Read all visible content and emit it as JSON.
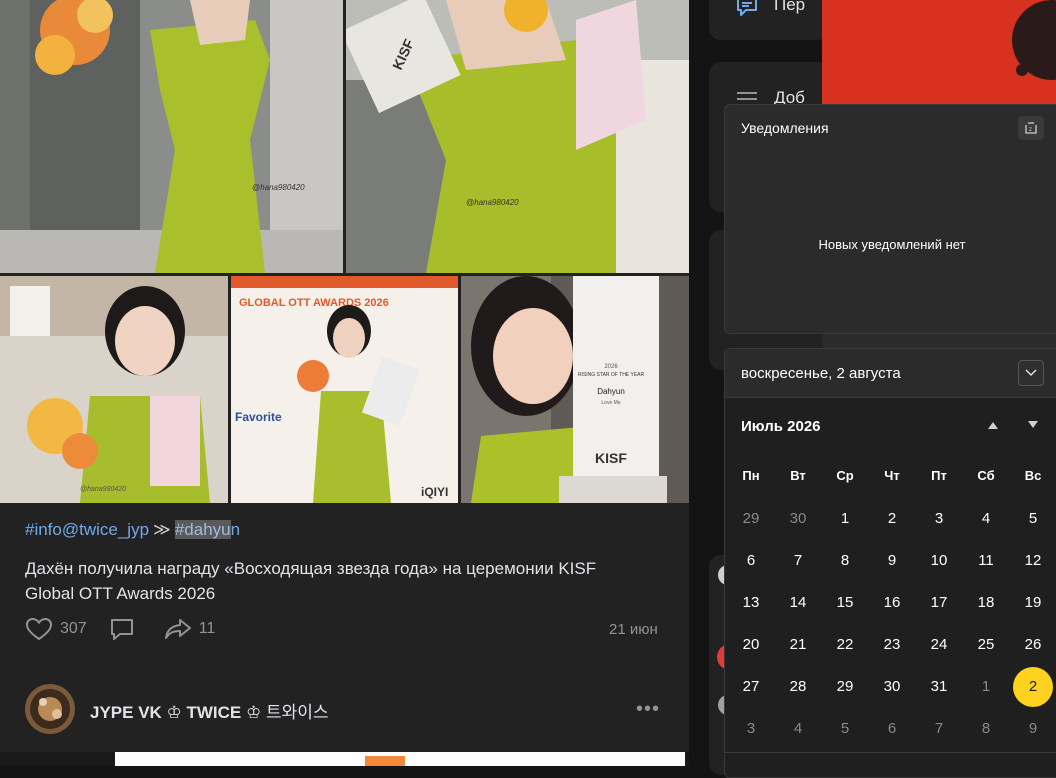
{
  "post": {
    "hashtag_1": "#info@twice_jyp",
    "separator": "≫",
    "hashtag_2_selected": "#dahyu",
    "hashtag_2_rest": "n",
    "text": "Дахён получила награду «Восходящая звезда года» на церемонии KISF Global OTT Awards 2026",
    "likes": "307",
    "shares": "11",
    "date": "21 июн",
    "photos": {
      "p1_watermark": "@hana980420",
      "p2_watermark": "@hana980420",
      "p3_watermark": "@hana980420",
      "p4_banner": "GLOBAL OTT AWARDS 2026",
      "p4_sponsor_1": "Favorite",
      "p4_sponsor_2": "iQIYI",
      "p5_trophy_year": "2026",
      "p5_trophy_title": "RISING STAR OF THE YEAR",
      "p5_trophy_name": "Dahyun",
      "p5_trophy_sub": "Love Me",
      "p5_trophy_logo": "KISF"
    }
  },
  "next_post": {
    "author": "JYPE VK ♔ TWICE ♔",
    "author_kr": "트와이스",
    "more": "•••"
  },
  "sidebar": {
    "item_1": "Пер",
    "item_2": "Доб"
  },
  "notifications": {
    "title": "Уведомления",
    "empty": "Новых уведомлений нет"
  },
  "calendar": {
    "current_date": "воскресенье, 2 августа",
    "month": "Июль 2026",
    "weekdays": [
      "Пн",
      "Вт",
      "Ср",
      "Чт",
      "Пт",
      "Сб",
      "Вс"
    ],
    "days": [
      [
        "29",
        "30",
        "1",
        "2",
        "3",
        "4",
        "5"
      ],
      [
        "6",
        "7",
        "8",
        "9",
        "10",
        "11",
        "12"
      ],
      [
        "13",
        "14",
        "15",
        "16",
        "17",
        "18",
        "19"
      ],
      [
        "20",
        "21",
        "22",
        "23",
        "24",
        "25",
        "26"
      ],
      [
        "27",
        "28",
        "29",
        "30",
        "31",
        "1",
        "2"
      ],
      [
        "3",
        "4",
        "5",
        "6",
        "7",
        "8",
        "9"
      ]
    ],
    "dim_cells": [
      [
        0,
        0
      ],
      [
        0,
        1
      ],
      [
        4,
        5
      ],
      [
        5,
        0
      ],
      [
        5,
        1
      ],
      [
        5,
        2
      ],
      [
        5,
        3
      ],
      [
        5,
        4
      ],
      [
        5,
        5
      ],
      [
        5,
        6
      ]
    ],
    "today_cell": [
      4,
      6
    ],
    "accent": "#ffd21f"
  },
  "colors": {
    "link": "#71aaeb",
    "dress": "#b7c92a",
    "bg": "#222222"
  }
}
